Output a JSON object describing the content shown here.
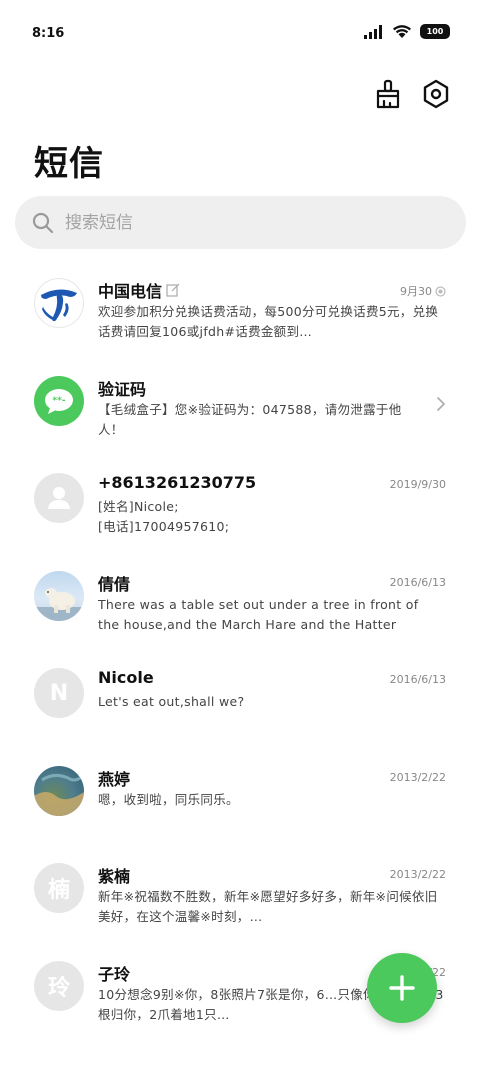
{
  "status_bar": {
    "time": "8:16",
    "battery": "100"
  },
  "header": {
    "title": "短信",
    "clean_icon": "broom-icon",
    "settings_icon": "hexagon-settings-icon"
  },
  "search": {
    "placeholder": "搜索短信"
  },
  "threads": [
    {
      "name": "中国电信",
      "date": "9月30",
      "preview": "欢迎参加积分兑换话费活动，每500分可兑换话费5元，兑换话费请回复106或jfdh#话费金额到…",
      "avatar": "china-telecom-logo"
    },
    {
      "name": "验证码",
      "date": "",
      "preview": "【毛绒盒子】您※验证码为：047588，请勿泄露于他人！",
      "avatar": "verification-code-icon"
    },
    {
      "name": "+8613261230775",
      "date": "2019/9/30",
      "preview": "[姓名]Nicole;\n[电话]17004957610;",
      "avatar": "person-icon"
    },
    {
      "name": "倩倩",
      "date": "2016/6/13",
      "preview": "There was a table set out under a tree in front of the house,and the March Hare and the Hatter were…",
      "avatar": "polar-bear-photo"
    },
    {
      "name": "Nicole",
      "date": "2016/6/13",
      "preview": "Let's eat out,shall we?",
      "avatar_letter": "N"
    },
    {
      "name": "燕婷",
      "date": "2013/2/22",
      "preview": "嗯，收到啦，同乐同乐。",
      "avatar": "landscape-photo"
    },
    {
      "name": "紫楠",
      "date": "2013/2/22",
      "preview": "新年※祝福数不胜数，新年※愿望好多好多，新年※问候依旧美好，在这个温馨※时刻，…",
      "avatar_letter": "楠"
    },
    {
      "name": "子玲",
      "date": "2013/2/22",
      "preview": "10分想念9别※你，8张照片7张是你，6…只像你，4根骨头3根归你，2爪着地1只…",
      "avatar_letter": "玲"
    }
  ],
  "fab": {
    "icon": "plus-icon"
  },
  "colors": {
    "accent": "#4cc95c",
    "telecom_blue": "#1d59b2",
    "search_bg": "#efefef"
  }
}
